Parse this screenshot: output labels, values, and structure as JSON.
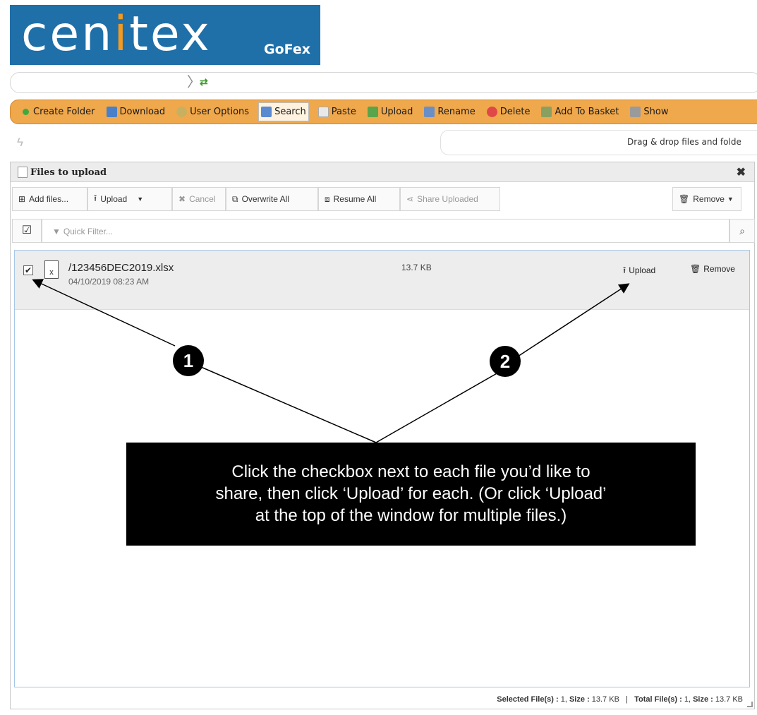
{
  "logo": {
    "word_before": "cen",
    "word_i": "i",
    "word_after": "tex",
    "sub": "GoFex"
  },
  "toolbar": {
    "items": [
      {
        "label": "Create Folder",
        "icon": "create-folder-icon"
      },
      {
        "label": "Download",
        "icon": "download-icon"
      },
      {
        "label": "User Options",
        "icon": "user-options-icon"
      },
      {
        "label": "Search",
        "icon": "search-icon",
        "active": true
      },
      {
        "label": "Paste",
        "icon": "paste-icon"
      },
      {
        "label": "Upload",
        "icon": "upload-icon"
      },
      {
        "label": "Rename",
        "icon": "rename-icon"
      },
      {
        "label": "Delete",
        "icon": "delete-icon"
      },
      {
        "label": "Add To Basket",
        "icon": "basket-icon"
      },
      {
        "label": "Show",
        "icon": "show-icon"
      }
    ]
  },
  "dropzone": {
    "text": "Drag & drop files and folde"
  },
  "dialog": {
    "title": "Files to upload",
    "buttons": {
      "add_files": "Add files...",
      "upload": "Upload",
      "cancel": "Cancel",
      "overwrite_all": "Overwrite All",
      "resume_all": "Resume All",
      "share_uploaded": "Share Uploaded",
      "remove": "Remove"
    },
    "filter_placeholder": "Quick Filter...",
    "files": [
      {
        "name": "/123456DEC2019.xlsx",
        "date": "04/10/2019 08:23 AM",
        "size": "13.7 KB",
        "checked": true,
        "upload_label": "Upload",
        "remove_label": "Remove"
      }
    ],
    "status": {
      "selected_label": "Selected File(s) :",
      "selected_count": "1,",
      "selected_size_label": "Size :",
      "selected_size": "13.7 KB",
      "separator": "|",
      "total_label": "Total File(s) :",
      "total_count": "1,",
      "total_size_label": "Size :",
      "total_size": "13.7 KB"
    }
  },
  "annotations": {
    "marker_1": "1",
    "marker_2": "2",
    "callout_lines": [
      "Click the checkbox next to each file you’d like to",
      "share, then click ‘Upload’ for each. (Or click ‘Upload’",
      "at the top of the window for multiple files.)"
    ]
  }
}
